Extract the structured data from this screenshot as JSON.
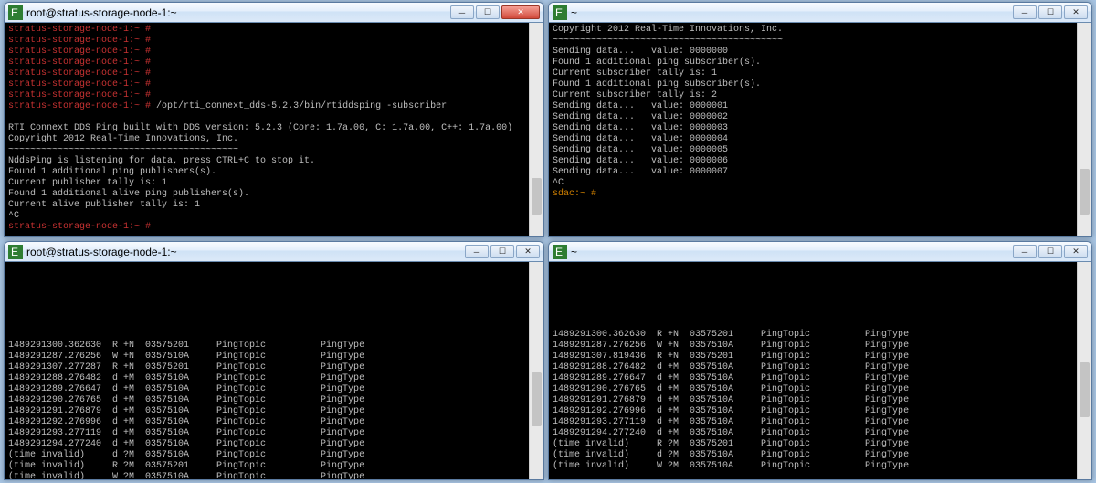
{
  "windows": {
    "tl": {
      "title": "root@stratus-storage-node-1:~"
    },
    "tr": {
      "title": "~"
    },
    "bl": {
      "title": "root@stratus-storage-node-1:~"
    },
    "br": {
      "title": "~"
    }
  },
  "tl": {
    "prompt": "stratus-storage-node-1:~ #",
    "cmd": "/opt/rti_connext_dds-5.2.3/bin/rtiddsping -subscriber",
    "lines": [
      "RTI Connext DDS Ping built with DDS version: 5.2.3 (Core: 1.7a.00, C: 1.7a.00, C++: 1.7a.00)",
      "Copyright 2012 Real-Time Innovations, Inc.",
      "~~~~~~~~~~~~~~~~~~~~~~~~~~~~~~~~~~~~~~~~~~",
      "NddsPing is listening for data, press CTRL+C to stop it.",
      "Found 1 additional ping publishers(s).",
      "Current publisher tally is: 1",
      "Found 1 additional alive ping publishers(s).",
      "Current alive publisher tally is: 1",
      "^C"
    ],
    "finalprompt": "stratus-storage-node-1:~ #"
  },
  "tr": {
    "lines": [
      "Copyright 2012 Real-Time Innovations, Inc.",
      "~~~~~~~~~~~~~~~~~~~~~~~~~~~~~~~~~~~~~~~~~~",
      "Sending data...   value: 0000000",
      "Found 1 additional ping subscriber(s).",
      "Current subscriber tally is: 1",
      "Found 1 additional ping subscriber(s).",
      "Current subscriber tally is: 2",
      "Sending data...   value: 0000001",
      "Sending data...   value: 0000002",
      "Sending data...   value: 0000003",
      "Sending data...   value: 0000004",
      "Sending data...   value: 0000005",
      "Sending data...   value: 0000006",
      "Sending data...   value: 0000007",
      "^C"
    ],
    "prompt": "sdac:~ #"
  },
  "table_lines": [
    "1489291300.362630  R +N  03575201     PingTopic          PingType",
    "1489291287.276256  W +N  0357510A     PingTopic          PingType",
    "1489291307.819436  R +N  03575201     PingTopic          PingType",
    "1489291288.276482  d +M  0357510A     PingTopic          PingType",
    "1489291289.276647  d +M  0357510A     PingTopic          PingType",
    "1489291290.276765  d +M  0357510A     PingTopic          PingType",
    "1489291291.276879  d +M  0357510A     PingTopic          PingType",
    "1489291292.276996  d +M  0357510A     PingTopic          PingType",
    "1489291293.277119  d +M  0357510A     PingTopic          PingType",
    "1489291294.277240  d +M  0357510A     PingTopic          PingType",
    "(time invalid)     R ?M  03575201     PingTopic          PingType",
    "(time invalid)     d ?M  0357510A     PingTopic          PingType",
    "(time invalid)     W ?M  0357510A     PingTopic          PingType"
  ],
  "table_lines_bl": [
    "1489291300.362630  R +N  03575201     PingTopic          PingType",
    "1489291287.276256  W +N  0357510A     PingTopic          PingType",
    "1489291307.277287  R +N  03575201     PingTopic          PingType",
    "1489291288.276482  d +M  0357510A     PingTopic          PingType",
    "1489291289.276647  d +M  0357510A     PingTopic          PingType",
    "1489291290.276765  d +M  0357510A     PingTopic          PingType",
    "1489291291.276879  d +M  0357510A     PingTopic          PingType",
    "1489291292.276996  d +M  0357510A     PingTopic          PingType",
    "1489291293.277119  d +M  0357510A     PingTopic          PingType",
    "1489291294.277240  d +M  0357510A     PingTopic          PingType",
    "(time invalid)     d ?M  0357510A     PingTopic          PingType",
    "(time invalid)     R ?M  03575201     PingTopic          PingType",
    "(time invalid)     W ?M  0357510A     PingTopic          PingType"
  ]
}
